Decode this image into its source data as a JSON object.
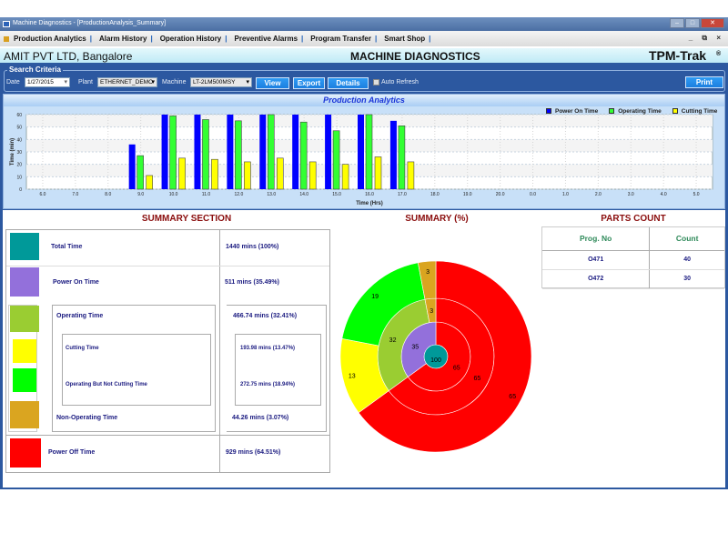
{
  "window": {
    "title": "Machine Diagnostics - [ProductionAnalysis_Summary]",
    "controls": [
      "–",
      "□",
      "✕"
    ]
  },
  "menu": {
    "items": [
      "Production Analytics",
      "Alarm History",
      "Operation History",
      "Preventive Alarms",
      "Program Transfer",
      "Smart Shop"
    ],
    "separator": "|",
    "mdi_controls": "_ ⧉ ×"
  },
  "header": {
    "company": "AMIT PVT LTD, Bangalore",
    "title": "MACHINE DIAGNOSTICS",
    "brand": "TPM-Trak",
    "reg": "®"
  },
  "search": {
    "legend": "Search Criteria",
    "date_label": "Date",
    "date_value": "1/27/2015",
    "plant_label": "Plant",
    "plant_value": "ETHERNET_DEMO",
    "machine_label": "Machine",
    "machine_value": "LT-2LM500MSY",
    "view": "View",
    "export": "Export",
    "details": "Details",
    "auto_refresh": "Auto Refresh",
    "auto_refresh_checked": false,
    "print": "Print"
  },
  "chart_panel_title": "Production Analytics",
  "chart_data": [
    {
      "type": "bar",
      "xlabel": "Time (Hrs)",
      "ylabel": "Time (min)",
      "ylim": [
        0,
        60
      ],
      "yticks": [
        0,
        10,
        20,
        30,
        40,
        50,
        60
      ],
      "grid": true,
      "legend": "top-right",
      "categories": [
        "6.0",
        "7.0",
        "8.0",
        "9.0",
        "10.0",
        "11.0",
        "12.0",
        "13.0",
        "14.0",
        "15.0",
        "16.0",
        "17.0",
        "18.0",
        "19.0",
        "20.0",
        "0.0",
        "1.0",
        "2.0",
        "3.0",
        "4.0",
        "5.0"
      ],
      "series": [
        {
          "name": "Power On Time",
          "color": "#0000ff",
          "values": [
            0,
            0,
            0,
            36,
            60,
            60,
            60,
            60,
            60,
            60,
            60,
            55,
            0,
            0,
            0,
            0,
            0,
            0,
            0,
            0,
            0
          ]
        },
        {
          "name": "Operating Time",
          "color": "#33ff33",
          "values": [
            0,
            0,
            0,
            27,
            59,
            56,
            55,
            60,
            54,
            47,
            60,
            51,
            0,
            0,
            0,
            0,
            0,
            0,
            0,
            0,
            0
          ]
        },
        {
          "name": "Cutting Time",
          "color": "#ffff00",
          "values": [
            0,
            0,
            0,
            11,
            25,
            24,
            22,
            25,
            22,
            20,
            26,
            22,
            0,
            0,
            0,
            0,
            0,
            0,
            0,
            0,
            0
          ]
        }
      ]
    },
    {
      "type": "pie",
      "title": "SUMMARY (%)",
      "rings": [
        [
          {
            "label": "100",
            "value": 100,
            "color": "#009999"
          }
        ],
        [
          {
            "label": "65",
            "value": 65,
            "color": "#ff0000"
          },
          {
            "label": "35",
            "value": 35,
            "color": "#9370db"
          }
        ],
        [
          {
            "label": "65",
            "value": 65,
            "color": "#ff0000"
          },
          {
            "label": "32",
            "value": 32,
            "color": "#9acd32"
          },
          {
            "label": "3",
            "value": 3,
            "color": "#daa520"
          }
        ],
        [
          {
            "label": "65",
            "value": 65,
            "color": "#ff0000"
          },
          {
            "label": "13",
            "value": 13,
            "color": "#ffff00"
          },
          {
            "label": "19",
            "value": 19,
            "color": "#00ff00"
          },
          {
            "label": "3",
            "value": 3,
            "color": "#daa520"
          }
        ]
      ]
    }
  ],
  "summary": {
    "title": "SUMMARY SECTION",
    "rows": [
      {
        "label": "Total Time",
        "value": "1440 mins  (100%)",
        "color": "#009999"
      },
      {
        "label": "Power On Time",
        "value": "511 mins (35.49%)",
        "color": "#9370db"
      },
      {
        "label": "Operating Time",
        "value": "466.74 mins  (32.41%)",
        "color": "#9acd32"
      },
      {
        "label": "Cutting Time",
        "value": "193.98 mins  (13.47%)",
        "color": "#ffff00"
      },
      {
        "label": "Operating But Not Cutting Time",
        "value": "272.75 mins  (18.94%)",
        "color": "#00ff00"
      },
      {
        "label": "Non-Operating Time",
        "value": "44.26 mins  (3.07%)",
        "color": "#daa520"
      },
      {
        "label": "Power Off Time",
        "value": "929 mins  (64.51%)",
        "color": "#ff0000"
      }
    ]
  },
  "parts": {
    "title": "PARTS COUNT",
    "headers": [
      "Prog. No",
      "Count"
    ],
    "rows": [
      [
        "O471",
        "40"
      ],
      [
        "O472",
        "30"
      ]
    ]
  }
}
